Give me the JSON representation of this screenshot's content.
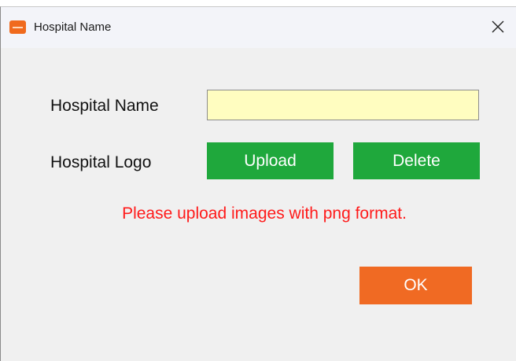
{
  "window": {
    "title": "Hospital Name",
    "icon": "app-logo-icon",
    "close_icon": "close-icon"
  },
  "form": {
    "hospital_name_label": "Hospital Name",
    "hospital_name_value": "",
    "hospital_logo_label": "Hospital Logo",
    "upload_label": "Upload",
    "delete_label": "Delete",
    "warning_text": "Please upload images with png format.",
    "ok_label": "OK"
  },
  "colors": {
    "dialog_bg": "#f0f0f0",
    "input_bg": "#fffdc0",
    "green_button": "#1fa83c",
    "ok_button": "#f06a23",
    "warning_text": "#ff1a1a"
  }
}
